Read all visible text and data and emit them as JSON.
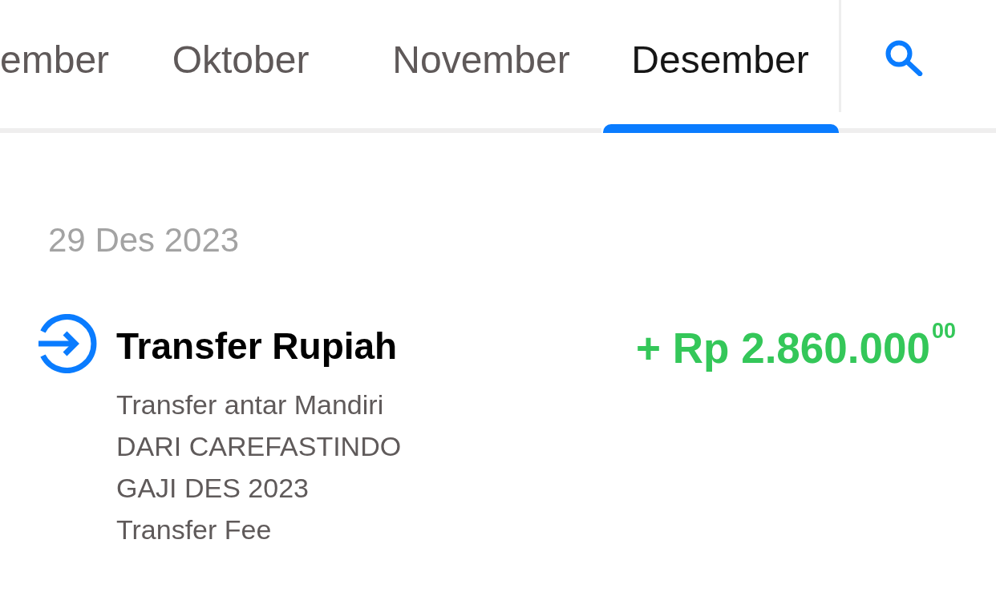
{
  "tabs": [
    {
      "label": "ember",
      "selected": false
    },
    {
      "label": "Oktober",
      "selected": false
    },
    {
      "label": "November",
      "selected": false
    },
    {
      "label": "Desember",
      "selected": true
    }
  ],
  "date_header": "29 Des 2023",
  "transactions": [
    {
      "title": "Transfer Rupiah",
      "amount": "+ Rp 2.860.000$^{00}$",
      "details": [
        "Transfer antar Mandiri",
        "DARI CAREFASTINDO",
        "GAJI DES 2023",
        "Transfer Fee"
      ]
    }
  ]
}
